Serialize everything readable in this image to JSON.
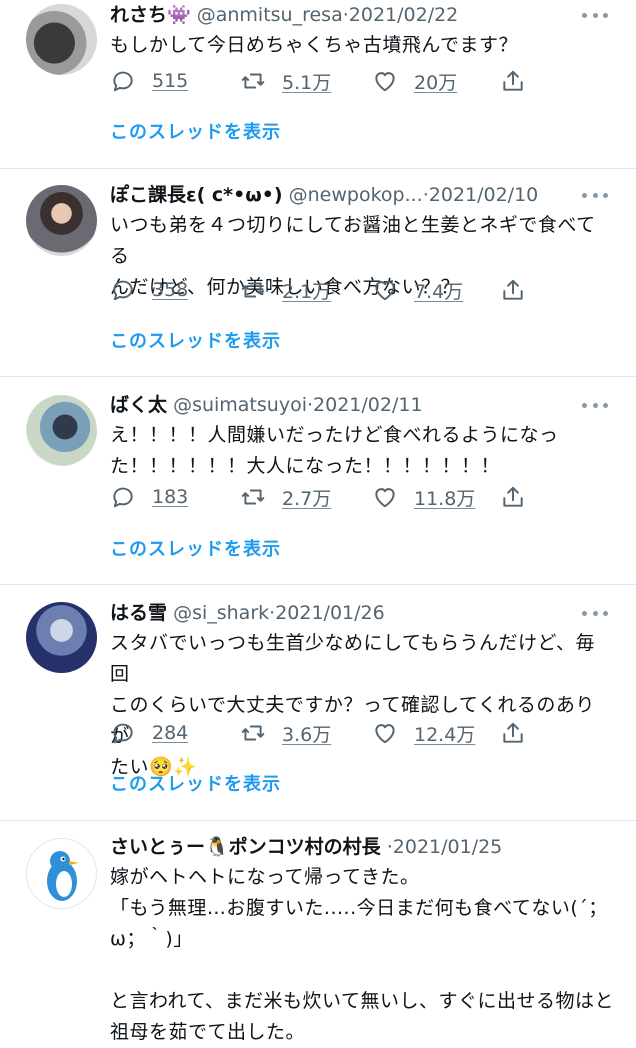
{
  "tweets": [
    {
      "name": "れさち👾",
      "handle": "@anmitsu_resa",
      "sep": "·",
      "date": "2021/02/22",
      "text": [
        "もしかして今日めちゃくちゃ古墳飛んでます？"
      ],
      "replies": "515",
      "retweets": "5.1万",
      "likes": "20万",
      "thread": "このスレッドを表示"
    },
    {
      "name": "ぽこ課長ε( c*•ω•)",
      "handle": "@newpokop...",
      "sep": "·",
      "date": "2021/02/10",
      "text": [
        "いつも弟を４つ切りにしてお醤油と生姜とネギで食べてる",
        "んだけど、何か美味しい食べ方ない？？"
      ],
      "replies": "358",
      "retweets": "2.1万",
      "likes": "7.4万",
      "thread": "このスレッドを表示"
    },
    {
      "name": "ばく太",
      "handle": "@suimatsuyoi",
      "sep": "·",
      "date": "2021/02/11",
      "text": [
        "え！！！！人間嫌いだったけど食べれるようになっ",
        "た！！！！！！大人になった！！！！！！！"
      ],
      "replies": "183",
      "retweets": "2.7万",
      "likes": "11.8万",
      "thread": "このスレッドを表示"
    },
    {
      "name": "はる雪",
      "handle": "@si_shark",
      "sep": "·",
      "date": "2021/01/26",
      "text": [
        "スタバでいっつも生首少なめにしてもらうんだけど、毎回",
        "このくらいで大丈夫ですか？って確認してくれるのありが",
        "たい🥺✨"
      ],
      "replies": "284",
      "retweets": "3.6万",
      "likes": "12.4万",
      "thread": "このスレッドを表示"
    },
    {
      "name": "さいとぅー🐧ポンコツ村の村長",
      "handle": "",
      "sep": "·",
      "date": "2021/01/25",
      "text": [
        "嫁がヘトヘトになって帰ってきた。",
        "「もう無理…お腹すいた.....今日まだ何も食べてない(´；",
        "ω；｀)」",
        "",
        "と言われて、まだ米も炊いて無いし、すぐに出せる物はと",
        "祖母を茹でて出した。"
      ]
    }
  ],
  "colors": {
    "accent": "#1d9bf0",
    "muted": "#536471"
  }
}
